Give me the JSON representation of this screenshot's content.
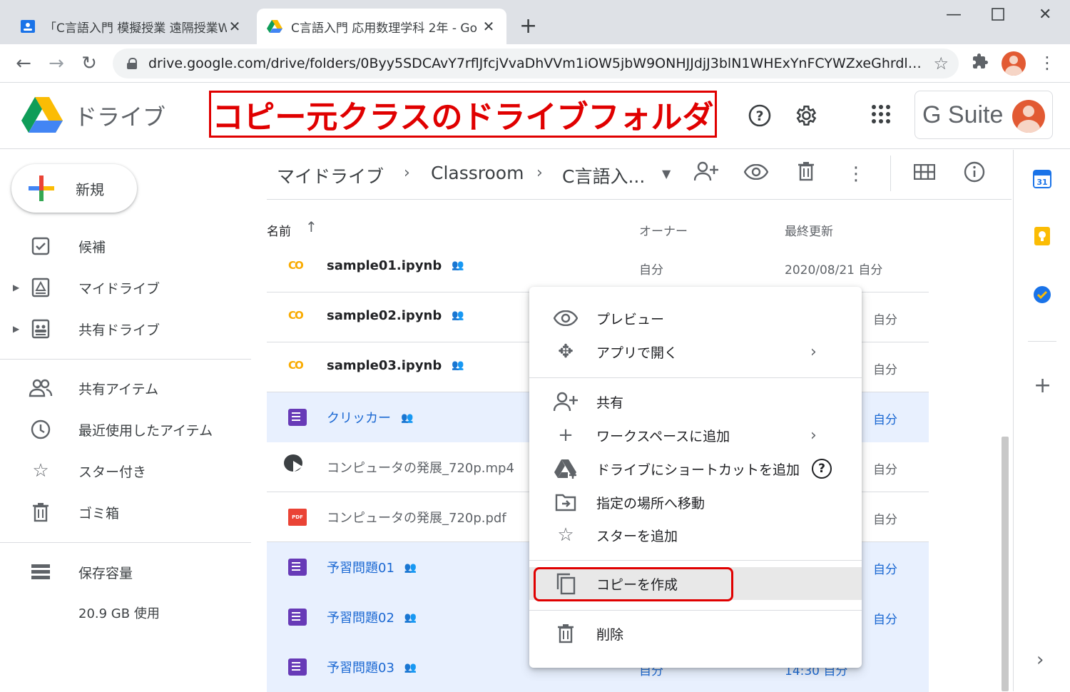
{
  "browser": {
    "tabs": [
      {
        "title": "「C言語入門 模擬授業 遠隔授業W",
        "active": false,
        "favicon": "classroom-icon"
      },
      {
        "title": "C言語入門 応用数理学科 2年 - Go",
        "active": true,
        "favicon": "drive-icon"
      }
    ],
    "url": "drive.google.com/drive/folders/0Byy5SDCAvY7rflJfcjVvaDhVVm1iOW5jbW9ONHJJdjJ3blN1WHExYnFCYWZxeGhrdlpUR..."
  },
  "header": {
    "app_name": "ドライブ",
    "annotation": "コピー元クラスのドライブフォルダ",
    "gsuite_label": "G Suite"
  },
  "sidebar": {
    "new_button": "新規",
    "items": [
      {
        "label": "候補",
        "icon": "check-square-icon"
      },
      {
        "label": "マイドライブ",
        "icon": "my-drive-icon"
      },
      {
        "label": "共有ドライブ",
        "icon": "shared-drive-icon"
      },
      {
        "label": "共有アイテム",
        "icon": "people-icon"
      },
      {
        "label": "最近使用したアイテム",
        "icon": "clock-icon"
      },
      {
        "label": "スター付き",
        "icon": "star-icon"
      },
      {
        "label": "ゴミ箱",
        "icon": "trash-icon"
      },
      {
        "label": "保存容量",
        "icon": "storage-icon"
      }
    ],
    "storage_usage": "20.9 GB 使用"
  },
  "breadcrumb": [
    "マイドライブ",
    "Classroom",
    "C言語入..."
  ],
  "list": {
    "columns": {
      "name": "名前",
      "owner": "オーナー",
      "modified": "最終更新"
    },
    "rows": [
      {
        "name": "sample01.ipynb",
        "type": "colab",
        "owner": "自分",
        "modified": "2020/08/21 自分",
        "selected": false
      },
      {
        "name": "sample02.ipynb",
        "type": "colab",
        "owner": "",
        "modified": "自分",
        "selected": false
      },
      {
        "name": "sample03.ipynb",
        "type": "colab",
        "owner": "",
        "modified": "自分",
        "selected": false
      },
      {
        "name": "クリッカー",
        "type": "form",
        "owner": "",
        "modified": "自分",
        "selected": true
      },
      {
        "name": "コンピュータの発展_720p.mp4",
        "type": "video",
        "owner": "",
        "modified": "自分",
        "selected": false
      },
      {
        "name": "コンピュータの発展_720p.pdf",
        "type": "pdf",
        "owner": "",
        "modified": "自分",
        "selected": false
      },
      {
        "name": "予習問題01",
        "type": "form",
        "owner": "",
        "modified": "自分",
        "selected": true
      },
      {
        "name": "予習問題02",
        "type": "form",
        "owner": "",
        "modified": "自分",
        "selected": true
      },
      {
        "name": "予習問題03",
        "type": "form",
        "owner": "自分",
        "modified": "14:30 自分",
        "selected": true
      }
    ]
  },
  "context_menu": {
    "items": [
      {
        "label": "プレビュー",
        "icon": "eye-icon"
      },
      {
        "label": "アプリで開く",
        "icon": "open-with-icon"
      },
      {
        "label": "共有",
        "icon": "add-person-icon"
      },
      {
        "label": "ワークスペースに追加",
        "icon": "plus-icon"
      },
      {
        "label": "ドライブにショートカットを追加",
        "icon": "drive-shortcut-icon"
      },
      {
        "label": "指定の場所へ移動",
        "icon": "move-folder-icon"
      },
      {
        "label": "スターを追加",
        "icon": "star-icon"
      },
      {
        "label": "コピーを作成",
        "icon": "copy-icon"
      },
      {
        "label": "削除",
        "icon": "trash-icon"
      }
    ]
  },
  "colors": {
    "accent": "#1967d2",
    "annotation": "#e00000",
    "selected_row": "#e8f0fe"
  }
}
